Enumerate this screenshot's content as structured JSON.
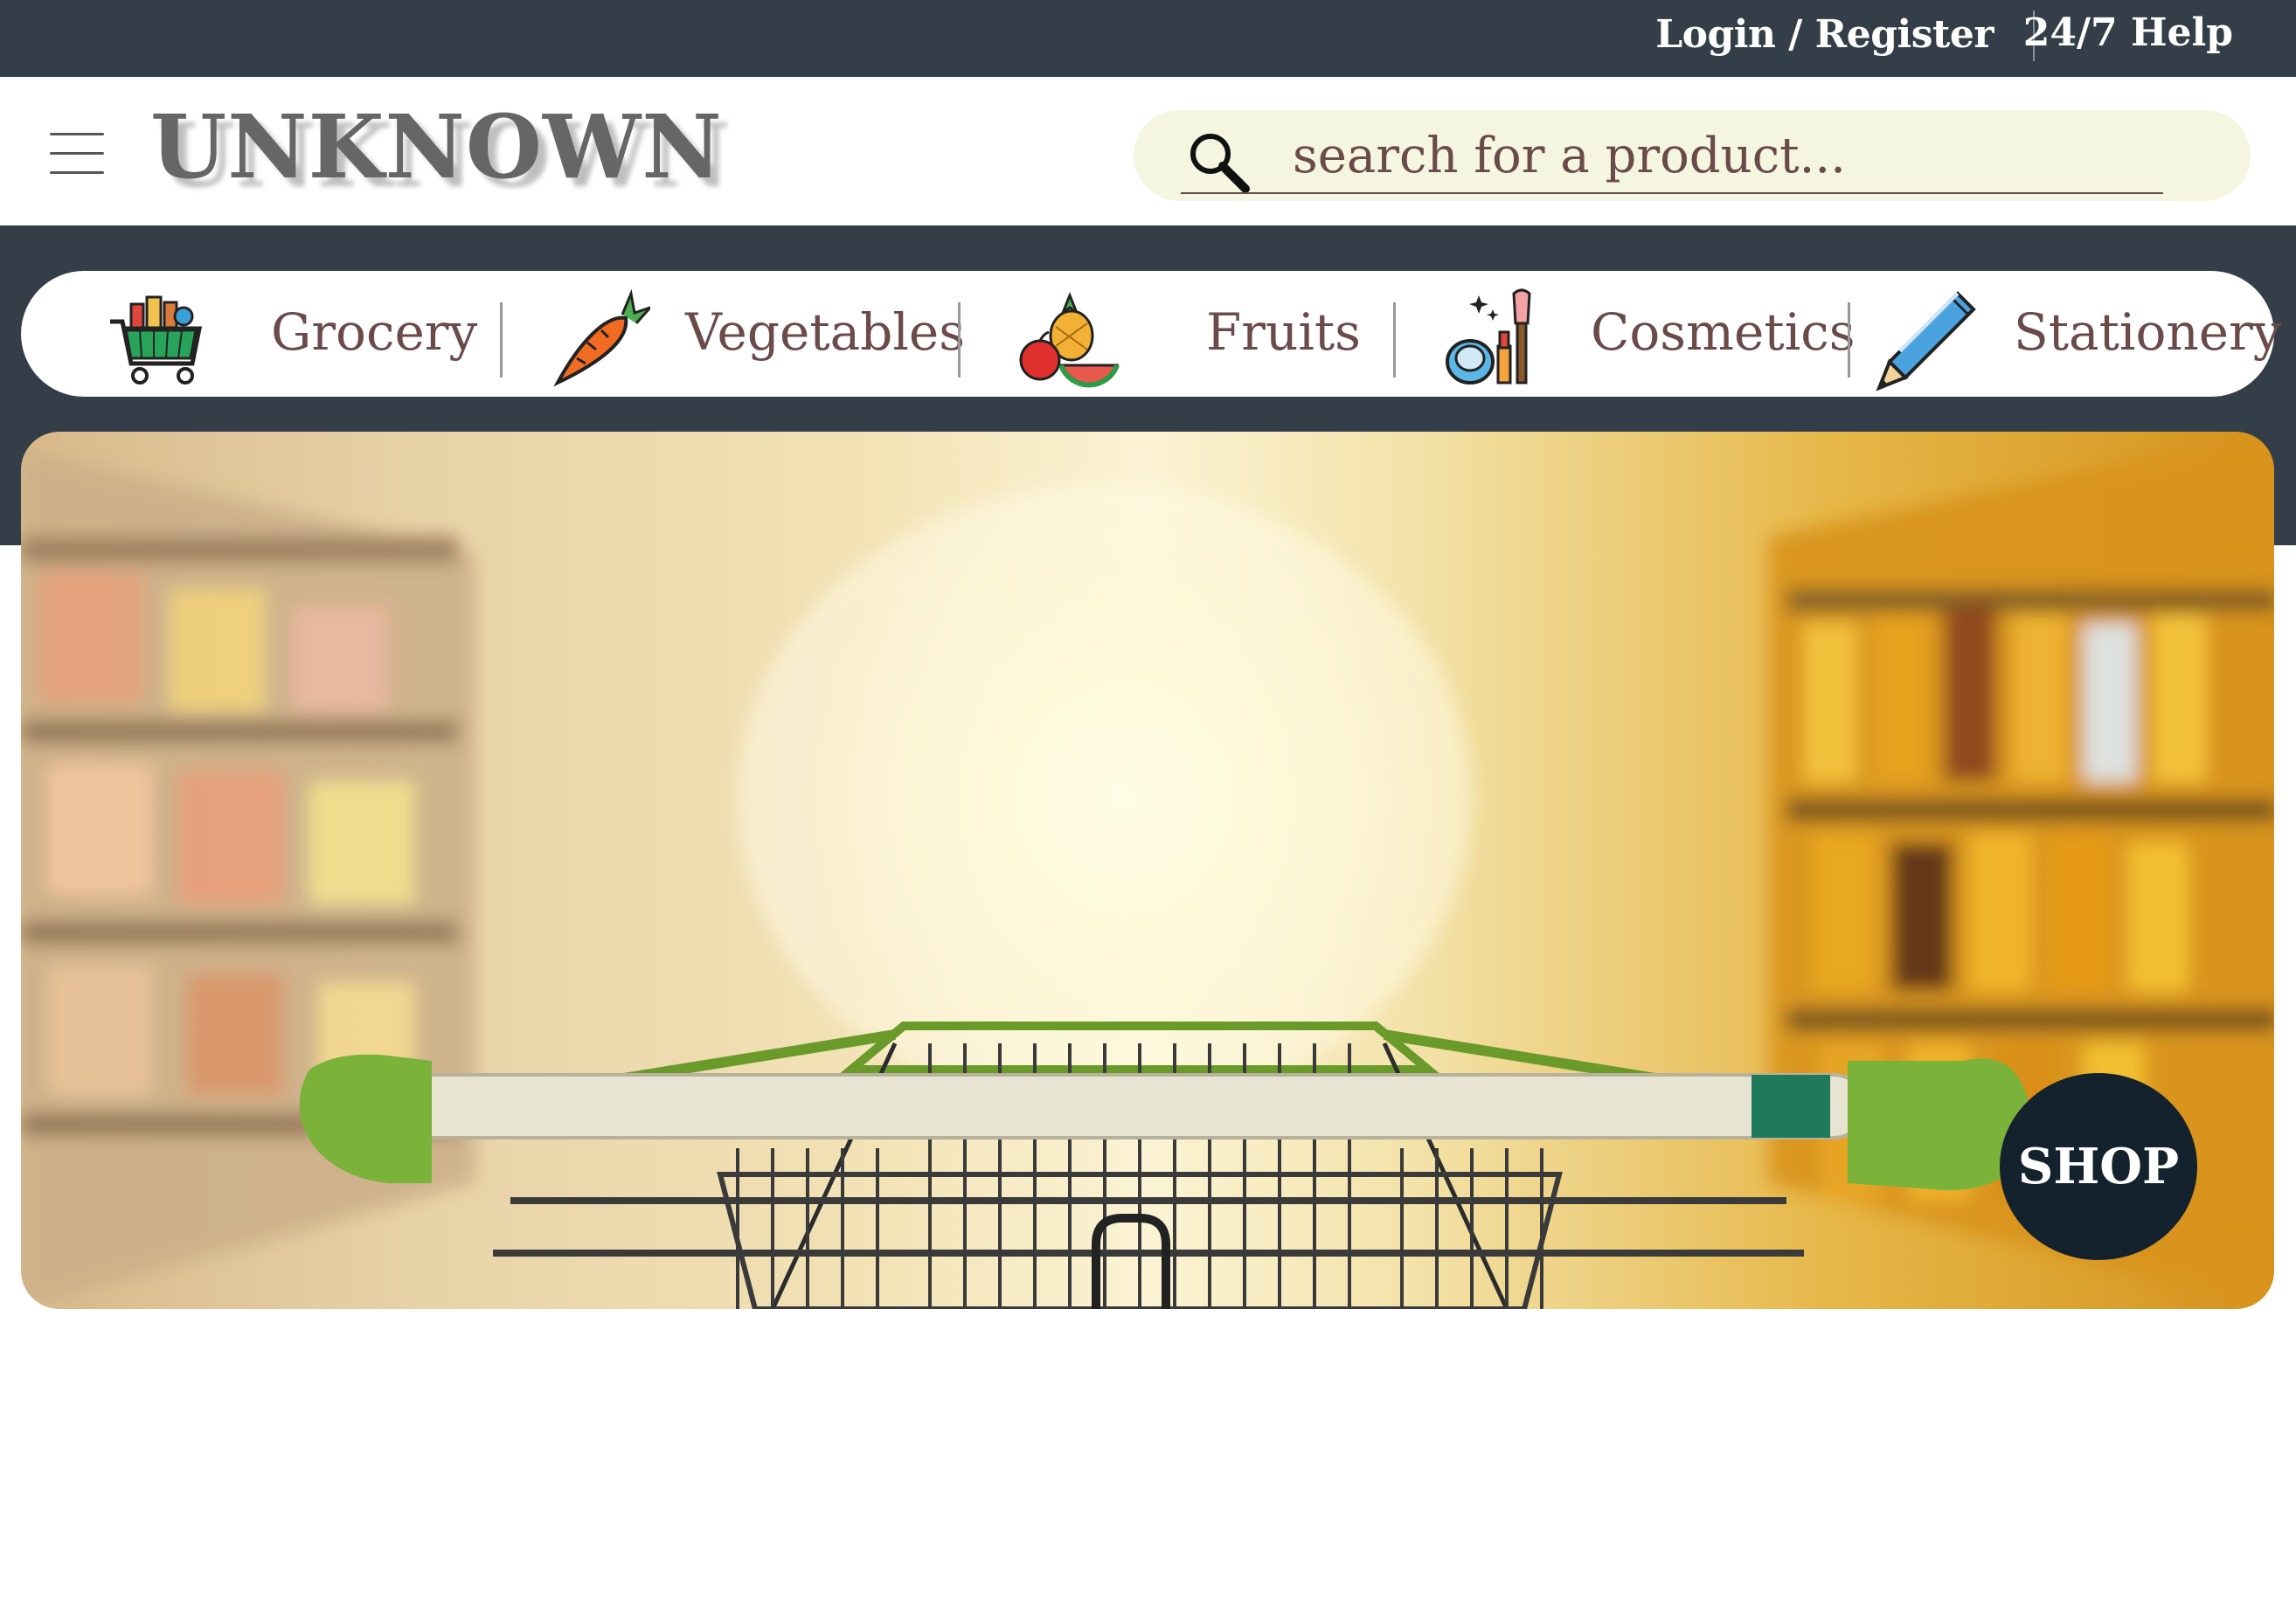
{
  "topbar": {
    "login_label": "Login / Register",
    "help_label": "24/7 Help"
  },
  "header": {
    "brand": "UNKNOWN",
    "search": {
      "placeholder": "search for a product...",
      "value": ""
    }
  },
  "categories": [
    {
      "label": "Grocery",
      "icon": "grocery-cart-icon"
    },
    {
      "label": "Vegetables",
      "icon": "carrot-icon"
    },
    {
      "label": "Fruits",
      "icon": "fruits-icon"
    },
    {
      "label": "Cosmetics",
      "icon": "cosmetics-icon"
    },
    {
      "label": "Stationery",
      "icon": "pencil-icon"
    }
  ],
  "hero": {
    "image": "supermarket-aisle-shopping-cart",
    "shop_label": "SHOP"
  },
  "colors": {
    "topbar": "#333e48",
    "search_bg": "#f4f6e0",
    "category_text": "#6b4a4a",
    "shop_button": "#14222e"
  }
}
